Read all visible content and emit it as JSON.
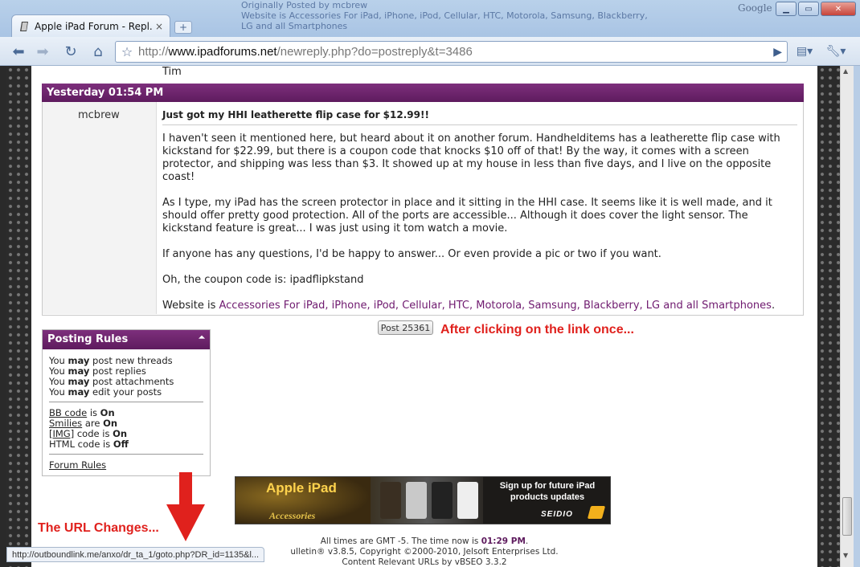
{
  "browser": {
    "tab_title": "Apple iPad Forum - Repl...",
    "tab_close": "×",
    "new_tab": "+",
    "google_label": "Google",
    "url_protocol": "http://",
    "url_domain": "www.ipadforums.net",
    "url_path": "/newreply.php?do=postreply&t=3486",
    "status_url": "http://outboundlink.me/anxo/dr_ta_1/goto.php?DR_id=1135&l...",
    "background_window_lines": [
      "Originally Posted by mcbrew",
      "Website is Accessories For iPad, iPhone, iPod, Cellular, HTC, Motorola, Samsung, Blackberry,",
      "LG and all Smartphones"
    ]
  },
  "post": {
    "prev_signature": "Tim",
    "date": "Yesterday 01:54 PM",
    "username": "mcbrew",
    "title": "Just got my HHI leatherette flip case for $12.99!!",
    "paragraphs": [
      "I haven't seen it mentioned here, but heard about it on another forum. Handhelditems has a leatherette flip case with kickstand for $22.99, but there is a coupon code that knocks $10 off of that! By the way, it comes with a screen protector, and shipping was less than $3. It showed up at my house in less than five days, and I live on the opposite coast!",
      "As I type, my iPad has the screen protector in place and it sitting in the HHI case. It seems like it is well made, and it should offer pretty good protection. All of the ports are accessible... Although it does cover the light sensor. The kickstand feature is great... I was just using it tom watch a movie.",
      "If anyone has any questions, I'd be happy to answer... Or even provide a pic or two if you want.",
      "Oh, the coupon code is: ipadflipkstand"
    ],
    "website_prefix": "Website is ",
    "website_link": "Accessories For iPad, iPhone, iPod, Cellular, HTC, Motorola, Samsung, Blackberry, LG and all Smartphones",
    "website_suffix": ".",
    "post_number": "Post 25361"
  },
  "annotations": {
    "after_click": "After clicking on the link once...",
    "url_changes": "The URL Changes..."
  },
  "rules": {
    "title": "Posting Rules",
    "you": "You",
    "may": "may",
    "perm1": "post new threads",
    "perm2": "post replies",
    "perm3": "post attachments",
    "perm4": "edit your posts",
    "bb_link": "BB code",
    "bb_is": "is",
    "bb_val": "On",
    "smilies_link": "Smilies",
    "smilies_are": "are",
    "smilies_val": "On",
    "img_link": "[IMG]",
    "img_code_is": "code is",
    "img_val": "On",
    "html_label": "HTML code is",
    "html_val": "Off",
    "forum_rules_link": "Forum Rules"
  },
  "banner": {
    "left_title": "Apple iPad",
    "left_sub": "Accessories",
    "signup": "Sign up for future iPad products updates",
    "brand": "SEIDIO"
  },
  "footer": {
    "time_prefix": "All times are GMT -5. The time now is",
    "time_value": "01:29 PM",
    "time_suffix": ".",
    "powered": "ulletin® v3.8.5, Copyright ©2000-2010, Jelsoft Enterprises Ltd.",
    "seo": "Content Relevant URLs by vBSEO 3.3.2"
  },
  "colors": {
    "header_purple": "#6d246c",
    "annotation_red": "#e0211d",
    "link_purple": "#6f1a6f"
  }
}
